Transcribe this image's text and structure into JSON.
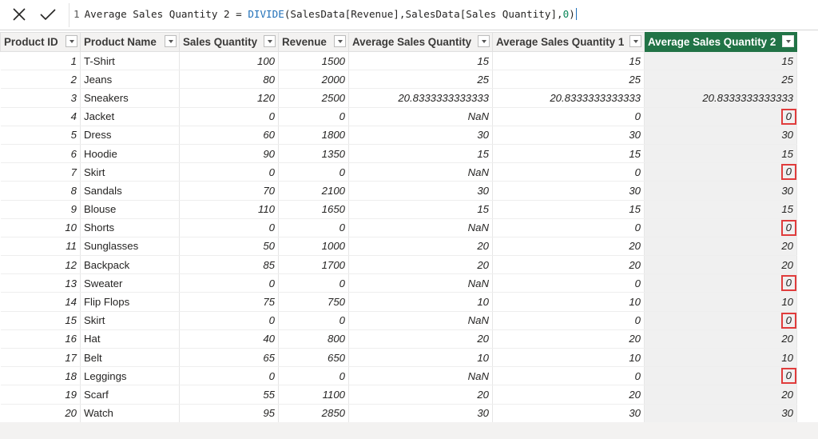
{
  "formula_bar": {
    "line_number": "1",
    "measure_name": "Average Sales Quantity 2 = ",
    "function_name": "DIVIDE",
    "open_paren": "(",
    "arg1": "SalesData[Revenue]",
    "comma1": ",",
    "arg2": "SalesData[Sales Quantity]",
    "comma2": ",",
    "arg3": "0",
    "close_paren": ")",
    "cancel_icon": "x-icon",
    "commit_icon": "check-icon"
  },
  "columns": [
    "Product ID",
    "Product Name",
    "Sales Quantity",
    "Revenue",
    "Average Sales Quantity",
    "Average Sales Quantity 1",
    "Average Sales Quantity 2"
  ],
  "active_column": "Average Sales Quantity 2",
  "colors": {
    "active_header": "#217346",
    "highlight_box": "#e03c3c",
    "formula_function": "#1f6fb8"
  },
  "rows": [
    [
      "1",
      "T-Shirt",
      "100",
      "1500",
      "15",
      "15",
      "15"
    ],
    [
      "2",
      "Jeans",
      "80",
      "2000",
      "25",
      "25",
      "25"
    ],
    [
      "3",
      "Sneakers",
      "120",
      "2500",
      "20.8333333333333",
      "20.8333333333333",
      "20.8333333333333"
    ],
    [
      "4",
      "Jacket",
      "0",
      "0",
      "NaN",
      "0",
      "0"
    ],
    [
      "5",
      "Dress",
      "60",
      "1800",
      "30",
      "30",
      "30"
    ],
    [
      "6",
      "Hoodie",
      "90",
      "1350",
      "15",
      "15",
      "15"
    ],
    [
      "7",
      "Skirt",
      "0",
      "0",
      "NaN",
      "0",
      "0"
    ],
    [
      "8",
      "Sandals",
      "70",
      "2100",
      "30",
      "30",
      "30"
    ],
    [
      "9",
      "Blouse",
      "110",
      "1650",
      "15",
      "15",
      "15"
    ],
    [
      "10",
      "Shorts",
      "0",
      "0",
      "NaN",
      "0",
      "0"
    ],
    [
      "11",
      "Sunglasses",
      "50",
      "1000",
      "20",
      "20",
      "20"
    ],
    [
      "12",
      "Backpack",
      "85",
      "1700",
      "20",
      "20",
      "20"
    ],
    [
      "13",
      "Sweater",
      "0",
      "0",
      "NaN",
      "0",
      "0"
    ],
    [
      "14",
      "Flip Flops",
      "75",
      "750",
      "10",
      "10",
      "10"
    ],
    [
      "15",
      "Skirt",
      "0",
      "0",
      "NaN",
      "0",
      "0"
    ],
    [
      "16",
      "Hat",
      "40",
      "800",
      "20",
      "20",
      "20"
    ],
    [
      "17",
      "Belt",
      "65",
      "650",
      "10",
      "10",
      "10"
    ],
    [
      "18",
      "Leggings",
      "0",
      "0",
      "NaN",
      "0",
      "0"
    ],
    [
      "19",
      "Scarf",
      "55",
      "1100",
      "20",
      "20",
      "20"
    ],
    [
      "20",
      "Watch",
      "95",
      "2850",
      "30",
      "30",
      "30"
    ]
  ],
  "highlighted_rows": [
    4,
    7,
    10,
    13,
    15,
    18
  ]
}
